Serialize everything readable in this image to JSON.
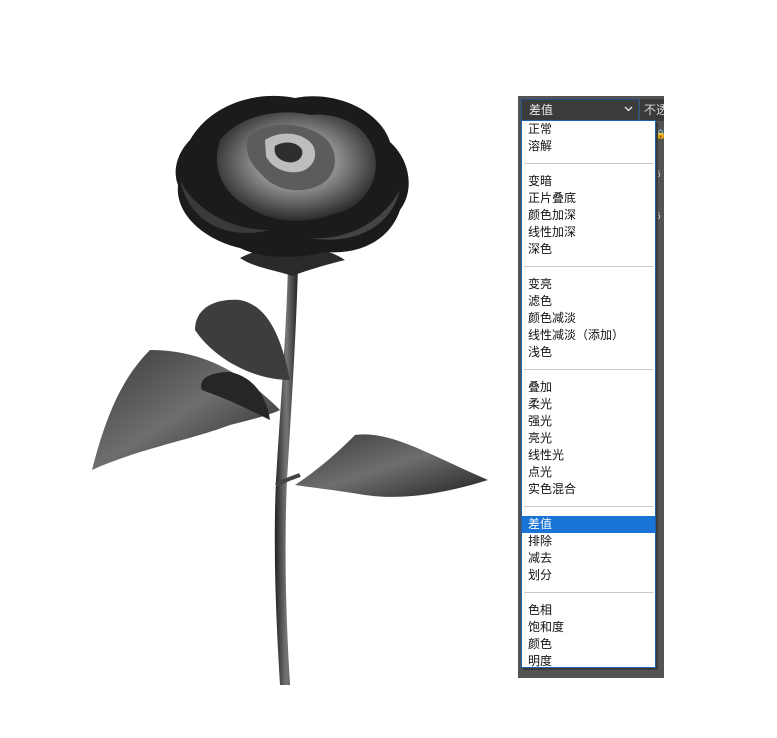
{
  "blend_mode": {
    "current": "差值",
    "opacity_label_partial": "不透"
  },
  "menu_groups": [
    [
      "正常",
      "溶解"
    ],
    [
      "变暗",
      "正片叠底",
      "颜色加深",
      "线性加深",
      "深色"
    ],
    [
      "变亮",
      "滤色",
      "颜色减淡",
      "线性减淡（添加）",
      "浅色"
    ],
    [
      "叠加",
      "柔光",
      "强光",
      "亮光",
      "线性光",
      "点光",
      "实色混合"
    ],
    [
      "差值",
      "排除",
      "减去",
      "划分"
    ],
    [
      "色相",
      "饱和度",
      "颜色",
      "明度"
    ]
  ],
  "icons": {
    "dropdown": "chevron-down-icon",
    "canvas": "rose-image"
  },
  "colors": {
    "selection": "#1a73d6",
    "list_border": "#1c63ad",
    "panel": "#535353"
  }
}
